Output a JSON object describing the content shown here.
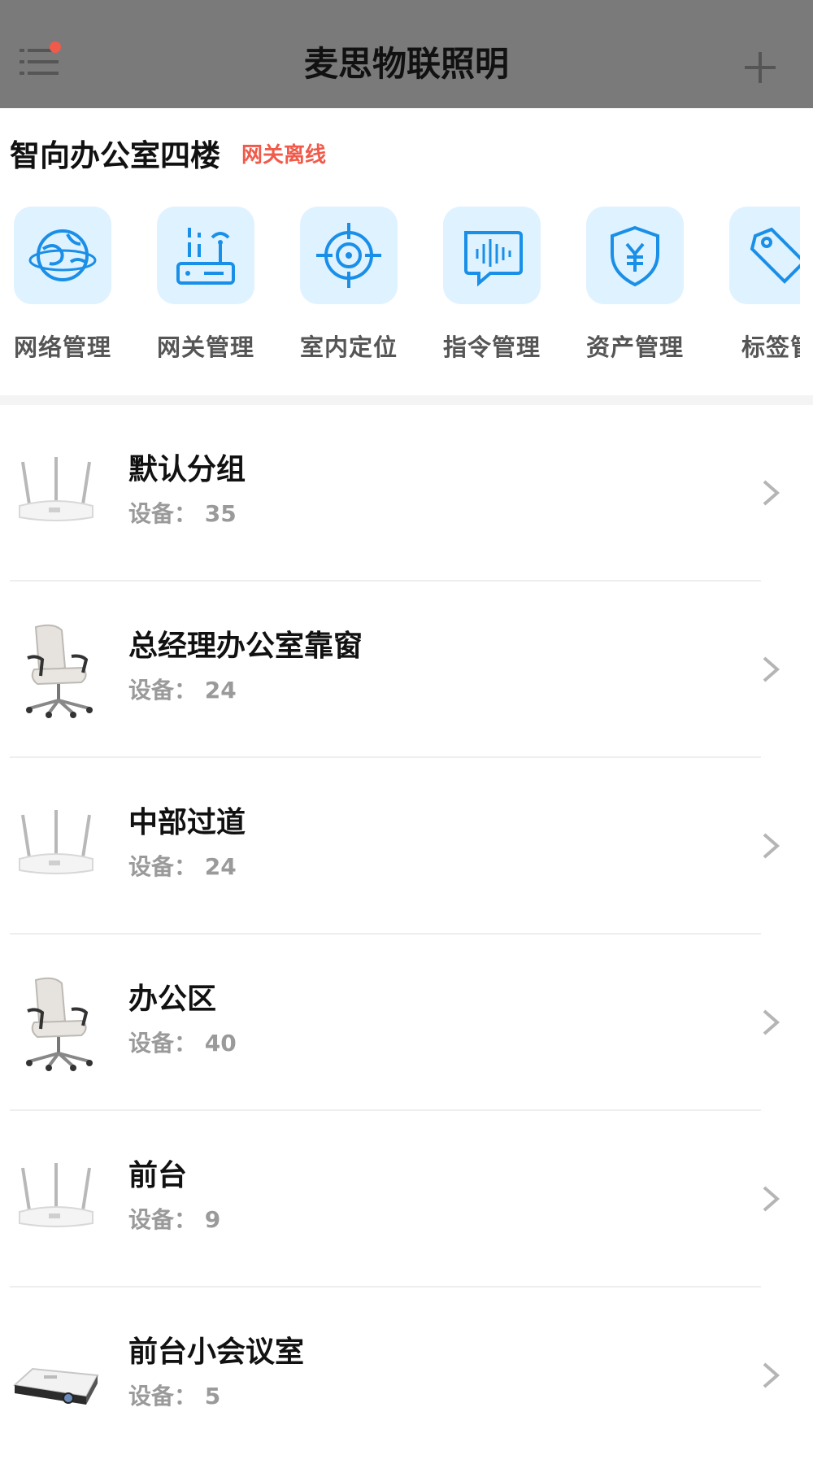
{
  "header": {
    "title": "麦思物联照明",
    "menu_icon": "menu-icon",
    "add_icon": "plus-icon",
    "colors": {
      "nav_bg": "#7a7a7a",
      "badge": "#f05a4a"
    }
  },
  "location": {
    "name": "智向办公室四楼",
    "status": "网关离线",
    "status_color": "#f05a4a"
  },
  "features": [
    {
      "label": "网络管理",
      "icon": "globe-icon"
    },
    {
      "label": "网关管理",
      "icon": "router-icon"
    },
    {
      "label": "室内定位",
      "icon": "crosshair-icon"
    },
    {
      "label": "指令管理",
      "icon": "voice-command-icon"
    },
    {
      "label": "资产管理",
      "icon": "yuan-shield-icon"
    },
    {
      "label": "标签管",
      "icon": "tag-icon"
    }
  ],
  "groups": [
    {
      "name": "默认分组",
      "count_label": "设备： 35",
      "image": "router"
    },
    {
      "name": "总经理办公室靠窗",
      "count_label": "设备： 24",
      "image": "office-chair"
    },
    {
      "name": "中部过道",
      "count_label": "设备： 24",
      "image": "router"
    },
    {
      "name": "办公区",
      "count_label": "设备： 40",
      "image": "office-chair"
    },
    {
      "name": "前台",
      "count_label": "设备： 9",
      "image": "router"
    },
    {
      "name": "前台小会议室",
      "count_label": "设备： 5",
      "image": "projector"
    }
  ]
}
